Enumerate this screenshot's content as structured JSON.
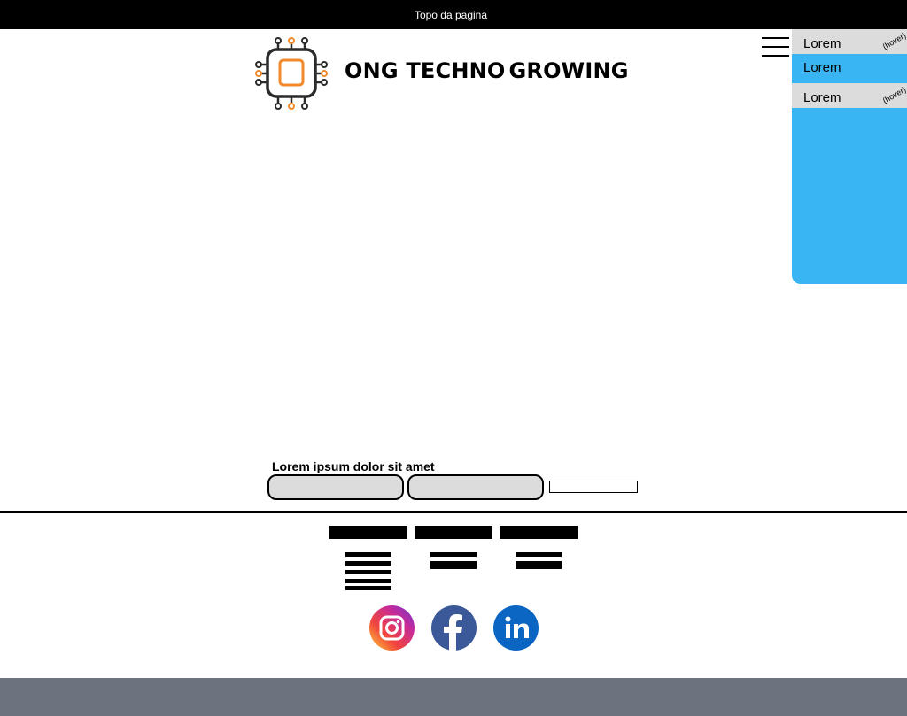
{
  "header": {
    "top_text": "Topo da pagina"
  },
  "brand": {
    "word1": "ONG TECHNO",
    "word2": "GROWING",
    "logo_icon": "chip-circuit-logo"
  },
  "menu": {
    "toggle_icon": "hamburger-icon",
    "items": [
      {
        "label": "Lorem",
        "state": "(hover)"
      },
      {
        "label": "Lorem",
        "state": ""
      },
      {
        "label": "Lorem",
        "state": "(hover)"
      }
    ]
  },
  "form": {
    "label": "Lorem ipsum dolor sit amet",
    "input1_value": "",
    "input2_value": "",
    "button_label": ""
  },
  "footer": {
    "social": [
      {
        "name": "instagram-icon"
      },
      {
        "name": "facebook-icon"
      },
      {
        "name": "linkedin-icon"
      }
    ]
  },
  "colors": {
    "menu_panel": "#39b5f4",
    "hover_bg": "#dcdcdc",
    "logo_accent": "#f08a2c",
    "bottom_bar": "#6c737e"
  }
}
